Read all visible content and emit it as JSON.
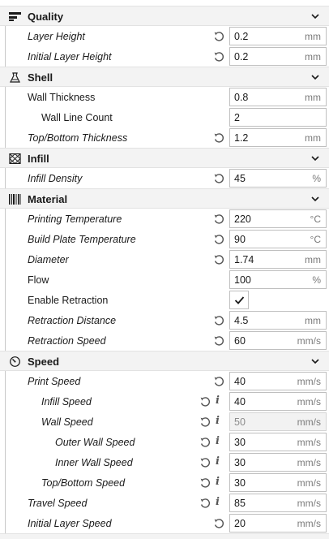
{
  "categories": {
    "quality": {
      "label": "Quality",
      "icon": "quality-icon"
    },
    "shell": {
      "label": "Shell",
      "icon": "shell-icon"
    },
    "infill": {
      "label": "Infill",
      "icon": "infill-icon"
    },
    "material": {
      "label": "Material",
      "icon": "material-icon"
    },
    "speed": {
      "label": "Speed",
      "icon": "speed-icon"
    }
  },
  "settings": {
    "layer_height": {
      "label": "Layer Height",
      "value": "0.2",
      "unit": "mm"
    },
    "initial_layer_height": {
      "label": "Initial Layer Height",
      "value": "0.2",
      "unit": "mm"
    },
    "wall_thickness": {
      "label": "Wall Thickness",
      "value": "0.8",
      "unit": "mm"
    },
    "wall_line_count": {
      "label": "Wall Line Count",
      "value": "2",
      "unit": ""
    },
    "top_bottom_thickness": {
      "label": "Top/Bottom Thickness",
      "value": "1.2",
      "unit": "mm"
    },
    "infill_density": {
      "label": "Infill Density",
      "value": "45",
      "unit": "%"
    },
    "printing_temperature": {
      "label": "Printing Temperature",
      "value": "220",
      "unit": "°C"
    },
    "build_plate_temperature": {
      "label": "Build Plate Temperature",
      "value": "90",
      "unit": "°C"
    },
    "diameter": {
      "label": "Diameter",
      "value": "1.74",
      "unit": "mm"
    },
    "flow": {
      "label": "Flow",
      "value": "100",
      "unit": "%"
    },
    "enable_retraction": {
      "label": "Enable Retraction",
      "checked": true
    },
    "retraction_distance": {
      "label": "Retraction Distance",
      "value": "4.5",
      "unit": "mm"
    },
    "retraction_speed": {
      "label": "Retraction Speed",
      "value": "60",
      "unit": "mm/s"
    },
    "print_speed": {
      "label": "Print Speed",
      "value": "40",
      "unit": "mm/s"
    },
    "infill_speed": {
      "label": "Infill Speed",
      "value": "40",
      "unit": "mm/s"
    },
    "wall_speed": {
      "label": "Wall Speed",
      "value": "50",
      "unit": "mm/s"
    },
    "outer_wall_speed": {
      "label": "Outer Wall Speed",
      "value": "30",
      "unit": "mm/s"
    },
    "inner_wall_speed": {
      "label": "Inner Wall Speed",
      "value": "30",
      "unit": "mm/s"
    },
    "top_bottom_speed": {
      "label": "Top/Bottom Speed",
      "value": "30",
      "unit": "mm/s"
    },
    "travel_speed": {
      "label": "Travel Speed",
      "value": "85",
      "unit": "mm/s"
    },
    "initial_layer_speed": {
      "label": "Initial Layer Speed",
      "value": "20",
      "unit": "mm/s"
    }
  },
  "info_glyph": "i"
}
